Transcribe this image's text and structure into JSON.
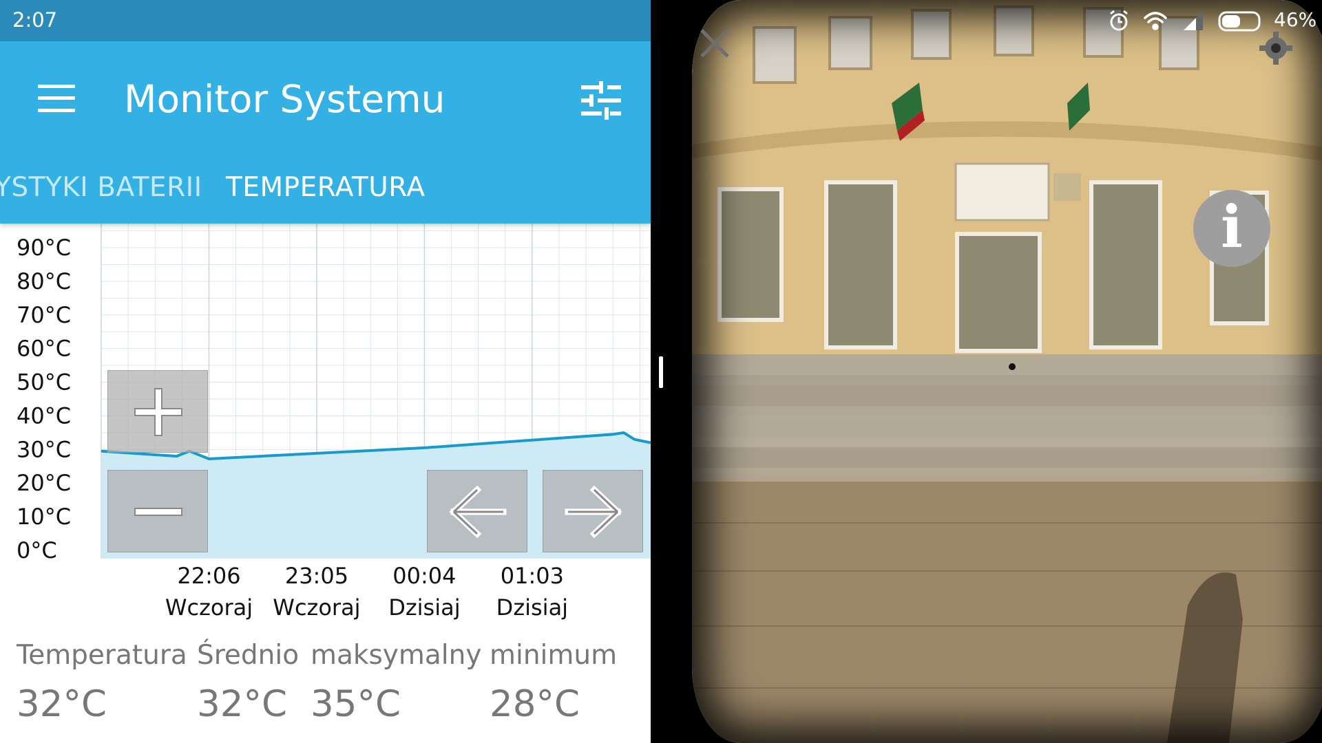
{
  "status_bar": {
    "time": "2:07",
    "battery": "46%"
  },
  "app_bar": {
    "title": "Monitor Systemu",
    "menu_icon": "menu-icon",
    "filter_icon": "tune-icon"
  },
  "tabs": [
    {
      "label": "YSTYKI BATERII",
      "active": false
    },
    {
      "label": "TEMPERATURA",
      "active": true
    }
  ],
  "chart_data": {
    "type": "area",
    "title": "",
    "xlabel": "",
    "ylabel": "",
    "ylim": [
      0,
      95
    ],
    "y_ticks": [
      "90°C",
      "80°C",
      "70°C",
      "60°C",
      "50°C",
      "40°C",
      "30°C",
      "20°C",
      "10°C",
      "0°C"
    ],
    "x_ticks": [
      {
        "time": "22:06",
        "day": "Wczoraj"
      },
      {
        "time": "23:05",
        "day": "Wczoraj"
      },
      {
        "time": "00:04",
        "day": "Dzisiaj"
      },
      {
        "time": "01:03",
        "day": "Dzisiaj"
      }
    ],
    "series": [
      {
        "values": [
          {
            "x": 0.0,
            "y": 29.5
          },
          {
            "x": 0.7,
            "y": 28.0
          },
          {
            "x": 0.82,
            "y": 29.5
          },
          {
            "x": 1.0,
            "y": 27.2
          },
          {
            "x": 3.0,
            "y": 30.5
          },
          {
            "x": 4.75,
            "y": 34.5
          },
          {
            "x": 4.85,
            "y": 35.0
          },
          {
            "x": 4.95,
            "y": 33.0
          },
          {
            "x": 5.1,
            "y": 32.0
          }
        ]
      }
    ],
    "x_tick_positions": [
      1,
      2,
      3,
      4
    ],
    "x_range": [
      0,
      5.1
    ],
    "colors": {
      "line": "#169ad0",
      "fill": "#cdeaf5",
      "grid": "#dde7ee"
    }
  },
  "chart_controls": {
    "zoom_in_icon": "plus-icon",
    "zoom_out_icon": "minus-icon",
    "prev_icon": "arrow-left-icon",
    "next_icon": "arrow-right-icon"
  },
  "stats": [
    {
      "label": "Temperatura",
      "value": "32°C"
    },
    {
      "label": "Średnio",
      "value": "32°C"
    },
    {
      "label": "maksymalny",
      "value": "35°C"
    },
    {
      "label": "minimum",
      "value": "28°C"
    }
  ],
  "vr_panel": {
    "close_icon": "close-icon",
    "settings_icon": "gear-icon",
    "info_icon": "info-icon",
    "status_icons": [
      "alarm-icon",
      "wifi-icon",
      "signal-icon",
      "battery-icon"
    ]
  }
}
